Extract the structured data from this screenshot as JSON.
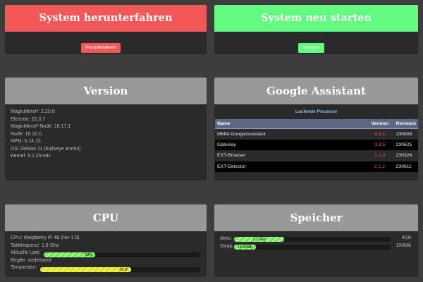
{
  "shutdown": {
    "title": "System herunterfahren",
    "button": "Herunterfahren"
  },
  "restart": {
    "title": "System neu starten",
    "button": "Neustart"
  },
  "version": {
    "title": "Version",
    "lines": [
      "MagicMirror²: 2.23.0",
      "Electron: 22.3.7",
      "MagicMirror² Node: 16.17.1",
      "Node: 16.20.0",
      "NPM: 6.14.15",
      "OS: Debian 11 (bullseye arm64)",
      "Kernel: 6.1.25-v8+"
    ]
  },
  "assistant": {
    "title": "Google Assistant",
    "subtitle": "Laufende Prozesse",
    "columns": [
      "Name",
      "Version",
      "Revision"
    ],
    "rows": [
      {
        "name": "MMM-GoogleAssistant",
        "version": "5.1.5",
        "revision": "230509"
      },
      {
        "name": "Gateway",
        "version": "3.3.5",
        "revision": "230625"
      },
      {
        "name": "EXT-Browser",
        "version": "1.2.0",
        "revision": "230324"
      },
      {
        "name": "EXT-Detector",
        "version": "2.1.2",
        "revision": "230611"
      }
    ]
  },
  "cpu": {
    "title": "CPU",
    "model": "CPU: Raspberry Pi 4B (rev 1.5)",
    "frequency": "Taktfrequenz: 1.8 Ghz",
    "load_label": "Aktuelle Last:",
    "load_text": "33%",
    "load_value": 0.33,
    "governor": "Regler: ondemand",
    "temp_label": "Temperatur:",
    "temp_text": "59.9°",
    "temp_value": 0.57
  },
  "memory": {
    "title": "Speicher",
    "active_label": "Aktiv:",
    "active_text": "1.27Gb",
    "active_value": 0.32,
    "active_total": "4Gb",
    "swap_label": "Swap:",
    "swap_text": "14.00Mb",
    "swap_value": 0.14,
    "swap_total": "100Mb"
  },
  "colors": {
    "danger": "#f25858",
    "success": "#62fa80",
    "panel_header": "#999999",
    "version_red": "#ff4b4b",
    "link_blue": "#7fbbf1"
  }
}
